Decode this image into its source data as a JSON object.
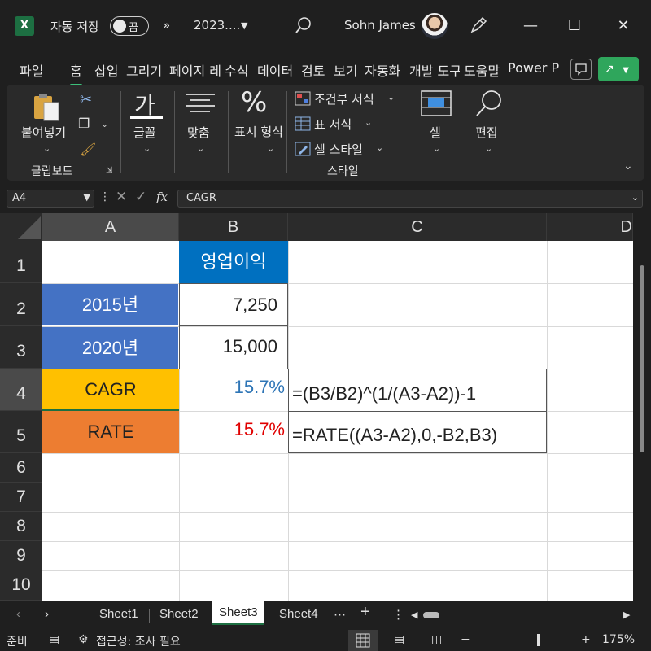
{
  "titlebar": {
    "app_icon": "X",
    "autosave_label": "자동 저장",
    "autosave_state": "끔",
    "more_label": "»",
    "file_name": "2023....",
    "user_name": "Sohn James",
    "minimize": "—",
    "maximize": "☐",
    "close": "✕"
  },
  "tabs": [
    "파일",
    "홈",
    "삽입",
    "그리기",
    "페이지 레",
    "수식",
    "데이터",
    "검토",
    "보기",
    "자동화",
    "개발 도구",
    "도움말",
    "Power P"
  ],
  "ribbon": {
    "paste_label": "붙여넣기",
    "clipboard_label": "클립보드",
    "font_label": "글꼴",
    "font_glyph": "가",
    "align_label": "맞춤",
    "number_label": "표시 형식",
    "number_glyph": "%",
    "cond_format": "조건부 서식",
    "table_format": "표 서식",
    "cell_style": "셀 스타일",
    "styles_label": "스타일",
    "cells_label": "셀",
    "editing_label": "편집"
  },
  "formula_bar": {
    "name_box": "A4",
    "formula": "CAGR",
    "fx_label": "fx"
  },
  "columns": [
    "A",
    "B",
    "C",
    "D"
  ],
  "rows": [
    "1",
    "2",
    "3",
    "4",
    "5",
    "6",
    "7",
    "8",
    "9",
    "10"
  ],
  "cells": {
    "B1": "영업이익",
    "A2": "2015년",
    "B2": "7,250",
    "A3": "2020년",
    "B3": "15,000",
    "A4": "CAGR",
    "B4": "15.7%",
    "C4": "=(B3/B2)^(1/(A3-A2))-1",
    "A5": "RATE",
    "B5": "15.7%",
    "C5": "=RATE((A3-A2),0,-B2,B3)"
  },
  "colors": {
    "header_blue": "#0070c0",
    "year_blue": "#4472c4",
    "cagr_yellow": "#ffc000",
    "rate_orange": "#ed7d31",
    "cagr_value": "#2e75b6",
    "rate_value": "#e00000"
  },
  "sheets": [
    "Sheet1",
    "Sheet2",
    "Sheet3",
    "Sheet4"
  ],
  "active_sheet": "Sheet3",
  "status": {
    "ready": "준비",
    "accessibility": "접근성: 조사 필요",
    "zoom": "175%"
  }
}
